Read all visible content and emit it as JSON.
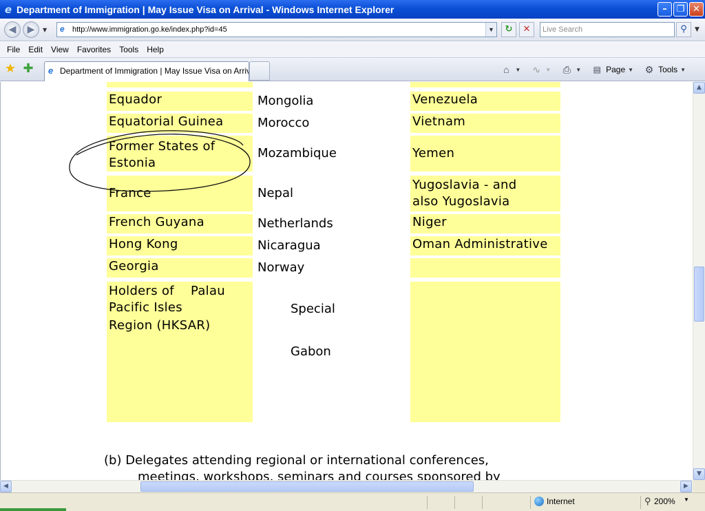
{
  "window": {
    "title": "Department of Immigration | May Issue Visa on Arrival - Windows Internet Explorer"
  },
  "toolbar": {
    "address": "http://www.immigration.go.ke/index.php?id=45",
    "search_placeholder": "Live Search"
  },
  "menu": [
    "File",
    "Edit",
    "View",
    "Favorites",
    "Tools",
    "Help"
  ],
  "tab": {
    "label": "Department of Immigration | May Issue Visa on Arrival"
  },
  "commandbar": {
    "page_label": "Page",
    "tools_label": "Tools"
  },
  "content": {
    "col1": {
      "equador": "Equador",
      "equatorial": "Equatorial Guinea",
      "former_line1": "Former States of",
      "former_line2": "Estonia",
      "france": "France",
      "french_guyana": "French Guyana",
      "hong_kong": "Hong Kong",
      "georgia": "Georgia",
      "holders_line1": "Holders of    Palau",
      "holders_line2": "Pacific Isles",
      "holders_line3": "Region (HKSAR)"
    },
    "col2": {
      "mongolia": "Mongolia",
      "morocco": "Morocco",
      "mozambique": "Mozambique",
      "nepal": "Nepal",
      "netherlands": "Netherlands",
      "nicaragua": "Nicaragua",
      "norway": "Norway",
      "special": "Special",
      "gabon": "Gabon"
    },
    "col3": {
      "venezuela": "Venezuela",
      "vietnam": "Vietnam",
      "yemen": "Yemen",
      "yugo_line1": "Yugoslavia - and",
      "yugo_line2": "also Yugoslavia",
      "niger": "Niger",
      "oman": "Oman Administrative"
    },
    "paragraph_b_line1": "(b)  Delegates attending regional or international conferences,",
    "paragraph_b_line2": "meetings, workshops, seminars and courses sponsored by"
  },
  "status": {
    "zone": "Internet",
    "zoom": "200%"
  },
  "colors": {
    "cell_bg": "#ffff99",
    "titlebar": "#0a4fd6"
  }
}
